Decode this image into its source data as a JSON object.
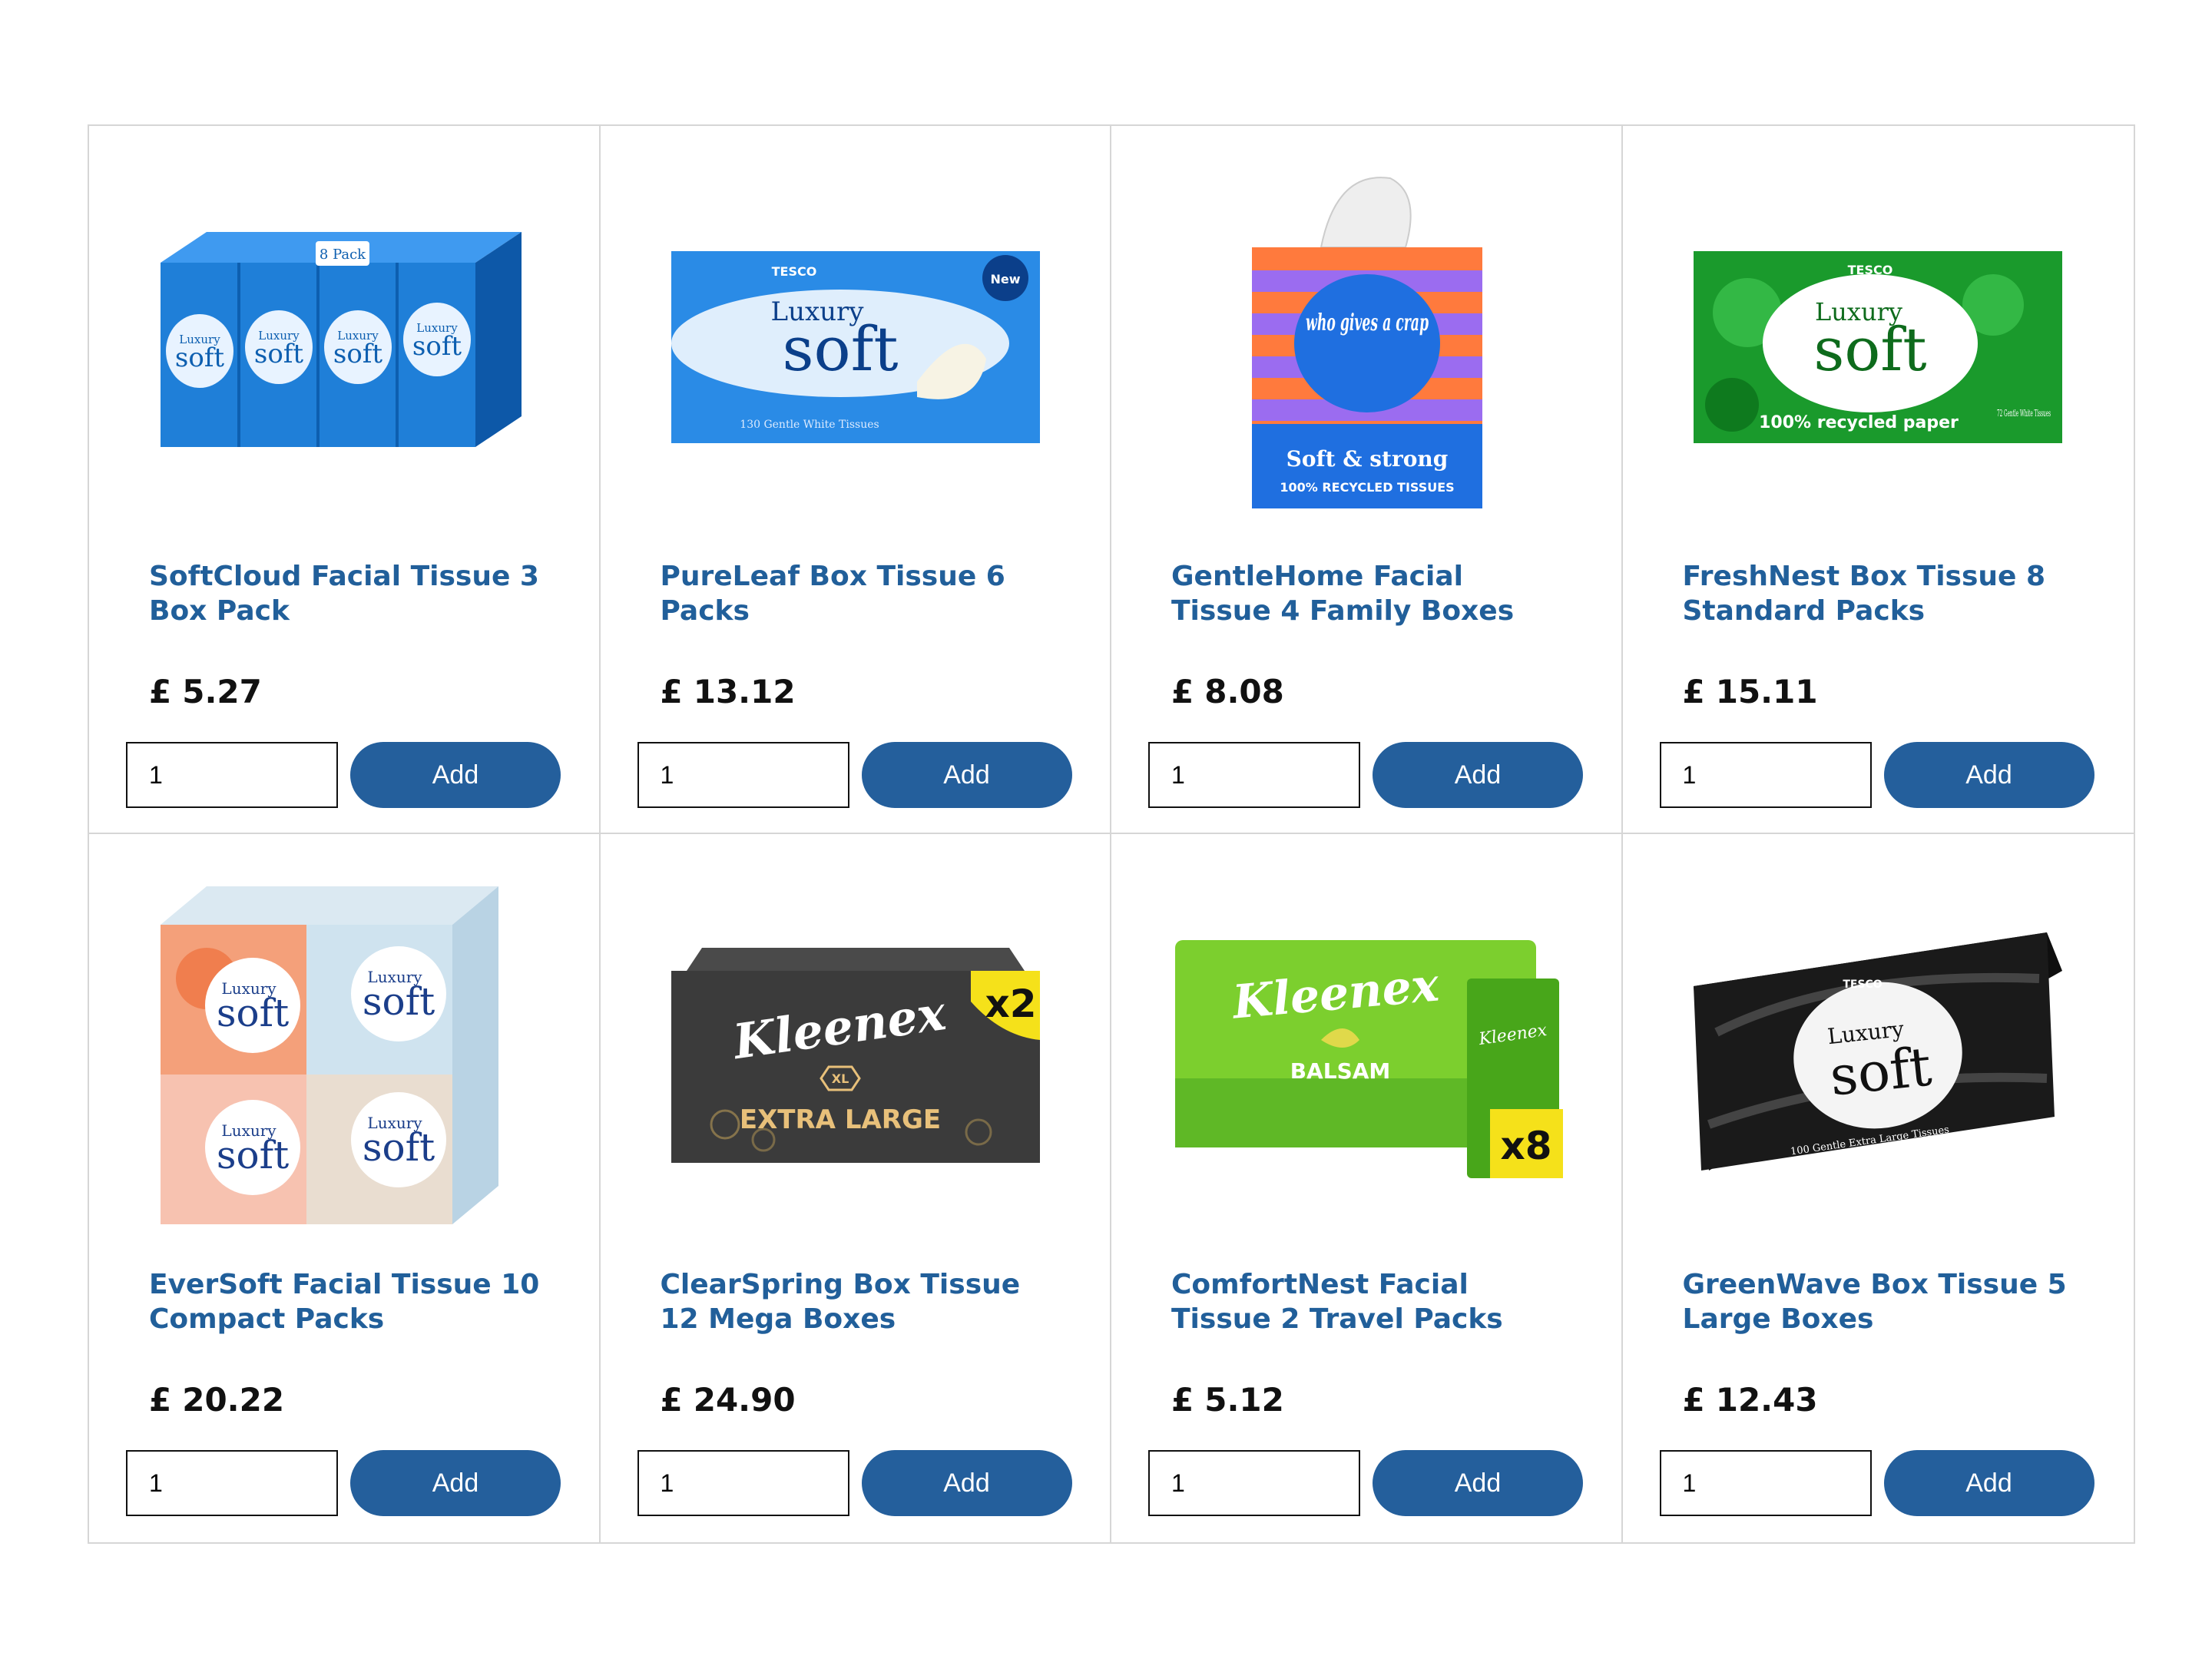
{
  "products": [
    {
      "name": "SoftCloud Facial Tissue 3 Box Pack",
      "currency": "£",
      "price": "5.27",
      "quantity": "1",
      "add_label": "Add",
      "image": {
        "icon": "tissue-multipack-image",
        "lines": [
          "8 Pack",
          "Luxury",
          "soft"
        ],
        "colors": [
          "#1f7fd8",
          "#0d5fb0"
        ]
      }
    },
    {
      "name": "PureLeaf Box Tissue 6 Packs",
      "currency": "£",
      "price": "13.12",
      "quantity": "1",
      "add_label": "Add",
      "image": {
        "icon": "tissue-box-image",
        "lines": [
          "TESCO",
          "Luxury",
          "soft",
          "New",
          "130 Gentle White Tissues"
        ],
        "colors": [
          "#2a8be6",
          "#0b57b5"
        ]
      }
    },
    {
      "name": "GentleHome Facial Tissue 4 Family Boxes",
      "currency": "£",
      "price": "8.08",
      "quantity": "1",
      "add_label": "Add",
      "image": {
        "icon": "striped-tissue-cube-image",
        "lines": [
          "who gives a crap",
          "Soft & strong",
          "100% RECYCLED TISSUES"
        ],
        "colors": [
          "#ff7a3d",
          "#9b6cf0",
          "#1f6fe0"
        ]
      }
    },
    {
      "name": "FreshNest Box Tissue 8 Standard Packs",
      "currency": "£",
      "price": "15.11",
      "quantity": "1",
      "add_label": "Add",
      "image": {
        "icon": "green-tissue-box-image",
        "lines": [
          "TESCO",
          "Luxury",
          "soft",
          "100% recycled paper",
          "72 Gentle White Tissues"
        ],
        "colors": [
          "#1a9a2c",
          "#0e7a1e"
        ]
      }
    },
    {
      "name": "EverSoft Facial Tissue 10 Compact Packs",
      "currency": "£",
      "price": "20.22",
      "quantity": "1",
      "add_label": "Add",
      "image": {
        "icon": "patterned-cube-pack-image",
        "lines": [
          "Luxury",
          "soft"
        ],
        "colors": [
          "#f4a07a",
          "#cfe3ef",
          "#f7d6c8"
        ]
      }
    },
    {
      "name": "ClearSpring Box Tissue 12 Mega Boxes",
      "currency": "£",
      "price": "24.90",
      "quantity": "1",
      "add_label": "Add",
      "image": {
        "icon": "dark-tissue-box-image",
        "lines": [
          "Kleenex",
          "XL",
          "EXTRA LARGE",
          "x2"
        ],
        "colors": [
          "#3b3b3b",
          "#e8c07a",
          "#f5e11a"
        ]
      }
    },
    {
      "name": "ComfortNest Facial Tissue 2 Travel Packs",
      "currency": "£",
      "price": "5.12",
      "quantity": "1",
      "add_label": "Add",
      "image": {
        "icon": "pocket-tissue-pack-image",
        "lines": [
          "Kleenex",
          "BALSAM",
          "x8"
        ],
        "colors": [
          "#7ccf2e",
          "#48a61a",
          "#f5e11a"
        ]
      }
    },
    {
      "name": "GreenWave Box Tissue 5 Large Boxes",
      "currency": "£",
      "price": "12.43",
      "quantity": "1",
      "add_label": "Add",
      "image": {
        "icon": "black-tissue-box-image",
        "lines": [
          "TESCO",
          "Luxury",
          "soft",
          "100 Gentle Extra Large Tissues"
        ],
        "colors": [
          "#1a1a1a",
          "#e0a83a"
        ]
      }
    }
  ],
  "colors": {
    "accent": "#245f9c",
    "title": "#215f9a",
    "border": "#d6d6d6"
  }
}
